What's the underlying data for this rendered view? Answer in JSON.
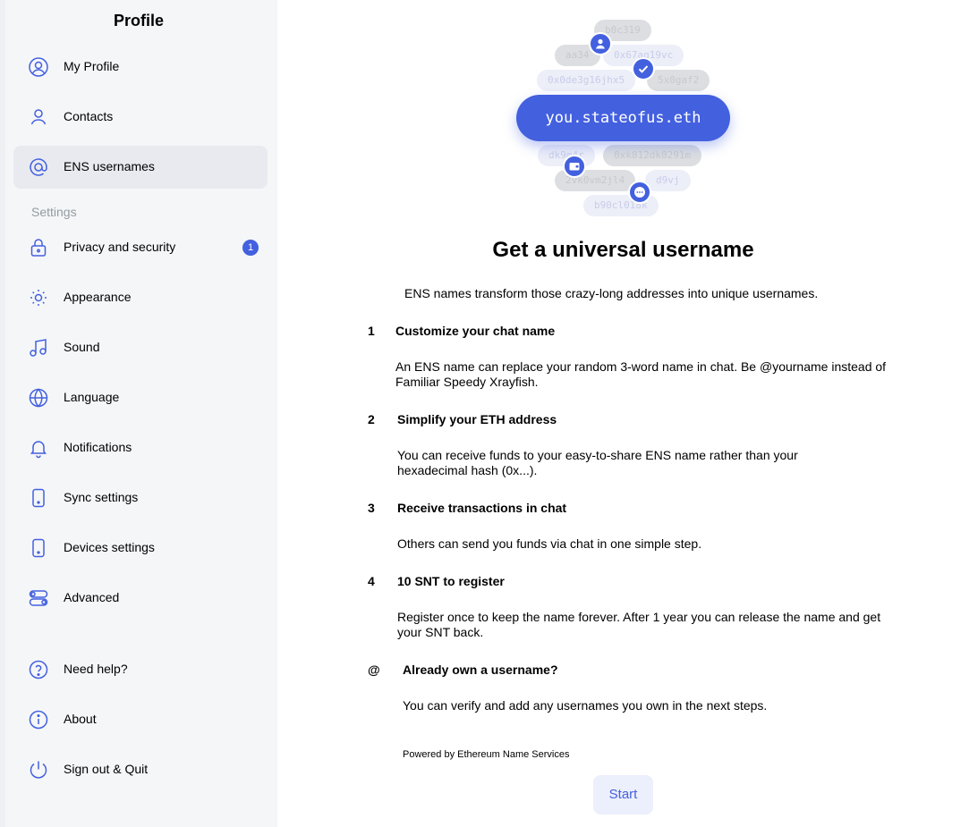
{
  "sidebar": {
    "title": "Profile",
    "section_settings": "Settings",
    "items": [
      {
        "label": "My Profile"
      },
      {
        "label": "Contacts"
      },
      {
        "label": "ENS usernames"
      },
      {
        "label": "Privacy and security",
        "badge": "1"
      },
      {
        "label": "Appearance"
      },
      {
        "label": "Sound"
      },
      {
        "label": "Language"
      },
      {
        "label": "Notifications"
      },
      {
        "label": "Sync settings"
      },
      {
        "label": "Devices settings"
      },
      {
        "label": "Advanced"
      },
      {
        "label": "Need help?"
      },
      {
        "label": "About"
      },
      {
        "label": "Sign out & Quit"
      }
    ],
    "icons": [
      "profile-icon",
      "contacts-icon",
      "at-icon",
      "lock-icon",
      "sun-icon",
      "music-note-icon",
      "globe-icon",
      "bell-icon",
      "phone-icon",
      "device-icon",
      "toggles-icon",
      "help-icon",
      "info-icon",
      "power-icon"
    ],
    "active_index": 2
  },
  "hero": {
    "username": "you.stateofus.eth",
    "chips": [
      "b0c319",
      "aa34",
      "0x67aq19vc",
      "0x0de3g16jhx5",
      "5x0gaf2",
      "dk9m4r",
      "0xk812dk0291m",
      "2vk0vm2jl4",
      "d9vj",
      "b90cl018k"
    ]
  },
  "main": {
    "title": "Get a universal username",
    "intro": "ENS names transform those crazy-long addresses into unique usernames.",
    "steps": [
      {
        "num": "1",
        "title": "Customize your chat name",
        "desc": "An ENS name can replace your random 3-word name in chat. Be @yourname instead of Familiar Speedy Xrayfish."
      },
      {
        "num": "2",
        "title": "Simplify your ETH address",
        "desc": "You can receive funds to your easy-to-share ENS name rather than your hexadecimal hash (0x...)."
      },
      {
        "num": "3",
        "title": "Receive transactions in chat",
        "desc": "Others can send you funds via chat in one simple step."
      },
      {
        "num": "4",
        "title": "10 SNT to register",
        "desc": "Register once to keep the name forever. After 1 year you can release the name and get your SNT back."
      },
      {
        "num": "@",
        "title": "Already own a username?",
        "desc": "You can verify and add any usernames you own in the next steps."
      }
    ],
    "powered_by": "Powered by Ethereum Name Services",
    "start_label": "Start"
  },
  "colors": {
    "accent": "#4360df",
    "sidebar_bg": "#f5f6f8",
    "active_bg": "#e8eaef",
    "muted": "#939ba1"
  }
}
